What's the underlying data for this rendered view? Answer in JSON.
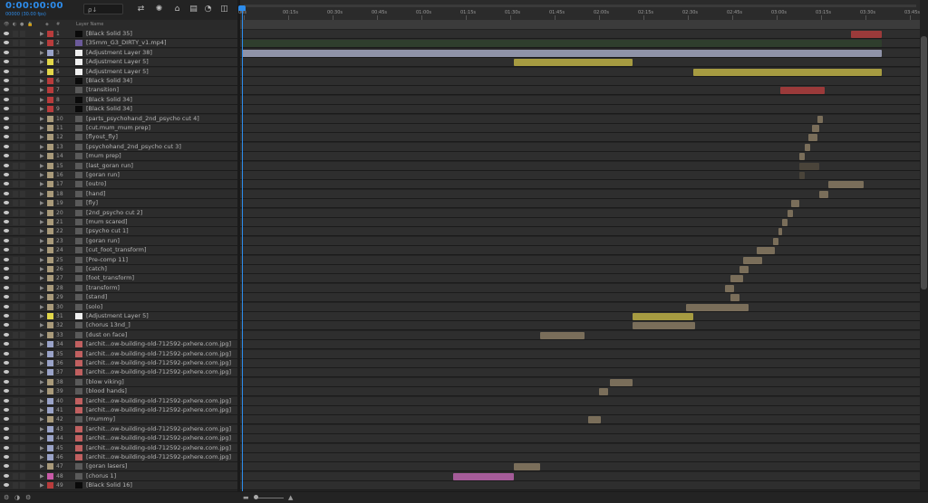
{
  "composition": {
    "timecode": "0:00:00:00",
    "fps": "00000 (30.00 fps)",
    "search_placeholder": "ρ↓"
  },
  "header": {
    "number_label": "#",
    "name_label": "Layer Name"
  },
  "ruler_labels": [
    "00s",
    "00:15s",
    "00:30s",
    "00:45s",
    "01:00s",
    "01:15s",
    "01:30s",
    "01:45s",
    "02:00s",
    "02:15s",
    "02:30s",
    "02:45s",
    "03:00s",
    "03:15s",
    "03:30s",
    "03:45s"
  ],
  "label_colors": {
    "red": "#b83c3c",
    "lavender": "#9aa3c8",
    "yellow": "#e2d74a",
    "sand": "#a99a7a",
    "pink": "#c95aa8"
  },
  "layers": [
    {
      "num": "1",
      "name": "[Black Solid 35]",
      "label": "red",
      "src": "black"
    },
    {
      "num": "2",
      "name": "[35mm_G3_DIRTY_v1.mp4]",
      "label": "red",
      "src": "video"
    },
    {
      "num": "3",
      "name": "[Adjustment Layer 38]",
      "label": "lavender",
      "src": "white"
    },
    {
      "num": "4",
      "name": "[Adjustment Layer 5]",
      "label": "yellow",
      "src": "white"
    },
    {
      "num": "5",
      "name": "[Adjustment Layer 5]",
      "label": "yellow",
      "src": "white"
    },
    {
      "num": "6",
      "name": "[Black Solid 34]",
      "label": "red",
      "src": "black"
    },
    {
      "num": "7",
      "name": "[transition]",
      "label": "red",
      "src": "comp"
    },
    {
      "num": "8",
      "name": "[Black Solid 34]",
      "label": "red",
      "src": "black"
    },
    {
      "num": "9",
      "name": "[Black Solid 34]",
      "label": "red",
      "src": "black"
    },
    {
      "num": "10",
      "name": "[parts_psychohand_2nd_psycho cut 4]",
      "label": "sand",
      "src": "comp"
    },
    {
      "num": "11",
      "name": "[cut.mum_mum prep]",
      "label": "sand",
      "src": "comp"
    },
    {
      "num": "12",
      "name": "[flyout_fly]",
      "label": "sand",
      "src": "comp"
    },
    {
      "num": "13",
      "name": "[psychohand_2nd_psycho cut 3]",
      "label": "sand",
      "src": "comp"
    },
    {
      "num": "14",
      "name": "[mum prep]",
      "label": "sand",
      "src": "comp"
    },
    {
      "num": "15",
      "name": "[last_goran run]",
      "label": "sand",
      "src": "comp"
    },
    {
      "num": "16",
      "name": "[goran run]",
      "label": "sand",
      "src": "comp"
    },
    {
      "num": "17",
      "name": "[outro]",
      "label": "sand",
      "src": "comp"
    },
    {
      "num": "18",
      "name": "[hand]",
      "label": "sand",
      "src": "comp"
    },
    {
      "num": "19",
      "name": "[fly]",
      "label": "sand",
      "src": "comp"
    },
    {
      "num": "20",
      "name": "[2nd_psycho cut 2]",
      "label": "sand",
      "src": "comp"
    },
    {
      "num": "21",
      "name": "[mum scared]",
      "label": "sand",
      "src": "comp"
    },
    {
      "num": "22",
      "name": "[psycho cut 1]",
      "label": "sand",
      "src": "comp"
    },
    {
      "num": "23",
      "name": "[goran run]",
      "label": "sand",
      "src": "comp"
    },
    {
      "num": "24",
      "name": "[cut_foot_transform]",
      "label": "sand",
      "src": "comp"
    },
    {
      "num": "25",
      "name": "[Pre-comp 11]",
      "label": "sand",
      "src": "comp"
    },
    {
      "num": "26",
      "name": "[catch]",
      "label": "sand",
      "src": "comp"
    },
    {
      "num": "27",
      "name": "[foot_transform]",
      "label": "sand",
      "src": "comp"
    },
    {
      "num": "28",
      "name": "[transform]",
      "label": "sand",
      "src": "comp"
    },
    {
      "num": "29",
      "name": "[stand]",
      "label": "sand",
      "src": "comp"
    },
    {
      "num": "30",
      "name": "[solo]",
      "label": "sand",
      "src": "comp"
    },
    {
      "num": "31",
      "name": "[Adjustment Layer 5]",
      "label": "yellow",
      "src": "white"
    },
    {
      "num": "32",
      "name": "[chorus 13nd_]",
      "label": "sand",
      "src": "comp"
    },
    {
      "num": "33",
      "name": "[dust on face]",
      "label": "sand",
      "src": "comp"
    },
    {
      "num": "34",
      "name": "[archit...ow-building-old-712592-pxhere.com.jpg]",
      "label": "lavender",
      "src": "image"
    },
    {
      "num": "35",
      "name": "[archit...ow-building-old-712592-pxhere.com.jpg]",
      "label": "lavender",
      "src": "image"
    },
    {
      "num": "36",
      "name": "[archit...ow-building-old-712592-pxhere.com.jpg]",
      "label": "lavender",
      "src": "image"
    },
    {
      "num": "37",
      "name": "[archit...ow-building-old-712592-pxhere.com.jpg]",
      "label": "lavender",
      "src": "image"
    },
    {
      "num": "38",
      "name": "[blow viking]",
      "label": "sand",
      "src": "comp"
    },
    {
      "num": "39",
      "name": "[blood hands]",
      "label": "sand",
      "src": "comp"
    },
    {
      "num": "40",
      "name": "[archit...ow-building-old-712592-pxhere.com.jpg]",
      "label": "lavender",
      "src": "image"
    },
    {
      "num": "41",
      "name": "[archit...ow-building-old-712592-pxhere.com.jpg]",
      "label": "lavender",
      "src": "image"
    },
    {
      "num": "42",
      "name": "[mummy]",
      "label": "sand",
      "src": "comp"
    },
    {
      "num": "43",
      "name": "[archit...ow-building-old-712592-pxhere.com.jpg]",
      "label": "lavender",
      "src": "image"
    },
    {
      "num": "44",
      "name": "[archit...ow-building-old-712592-pxhere.com.jpg]",
      "label": "lavender",
      "src": "image"
    },
    {
      "num": "45",
      "name": "[archit...ow-building-old-712592-pxhere.com.jpg]",
      "label": "lavender",
      "src": "image"
    },
    {
      "num": "46",
      "name": "[archit...ow-building-old-712592-pxhere.com.jpg]",
      "label": "lavender",
      "src": "image"
    },
    {
      "num": "47",
      "name": "[goran lasers]",
      "label": "sand",
      "src": "comp"
    },
    {
      "num": "48",
      "name": "[chorus 1]",
      "label": "pink",
      "src": "comp"
    },
    {
      "num": "49",
      "name": "[Black Solid 16]",
      "label": "red",
      "src": "black"
    }
  ],
  "clips": [
    {
      "row": 1,
      "color": "#9b3a3a",
      "start": 3.43,
      "end": 3.6
    },
    {
      "row": 2,
      "color": "#2f3e2d",
      "start": 0,
      "end": 3.6
    },
    {
      "row": 3,
      "color": "#8f93a8",
      "start": 0,
      "end": 3.6
    },
    {
      "row": 4,
      "color": "#a69b41",
      "start": 1.53,
      "end": 2.2
    },
    {
      "row": 5,
      "color": "#a69b41",
      "start": 2.54,
      "end": 3.6
    },
    {
      "row": 7,
      "color": "#9b3a3a",
      "start": 3.03,
      "end": 3.28
    },
    {
      "row": 10,
      "color": "#7a6e5a",
      "start": 3.24,
      "end": 3.27
    },
    {
      "row": 11,
      "color": "#7a6e5a",
      "start": 3.21,
      "end": 3.25
    },
    {
      "row": 12,
      "color": "#7a6e5a",
      "start": 3.19,
      "end": 3.24
    },
    {
      "row": 13,
      "color": "#7a6e5a",
      "start": 3.17,
      "end": 3.2
    },
    {
      "row": 14,
      "color": "#7a6e5a",
      "start": 3.14,
      "end": 3.17
    },
    {
      "row": 15,
      "color": "#4a443a",
      "start": 3.14,
      "end": 3.25
    },
    {
      "row": 16,
      "color": "#4a443a",
      "start": 3.14,
      "end": 3.17
    },
    {
      "row": 17,
      "color": "#7a6e5a",
      "start": 3.3,
      "end": 3.5
    },
    {
      "row": 18,
      "color": "#7a6e5a",
      "start": 3.25,
      "end": 3.3
    },
    {
      "row": 19,
      "color": "#7a6e5a",
      "start": 3.09,
      "end": 3.14
    },
    {
      "row": 20,
      "color": "#7a6e5a",
      "start": 3.07,
      "end": 3.1
    },
    {
      "row": 21,
      "color": "#7a6e5a",
      "start": 3.04,
      "end": 3.07
    },
    {
      "row": 22,
      "color": "#7a6e5a",
      "start": 3.02,
      "end": 3.04
    },
    {
      "row": 23,
      "color": "#7a6e5a",
      "start": 2.99,
      "end": 3.02
    },
    {
      "row": 24,
      "color": "#7a6e5a",
      "start": 2.9,
      "end": 3.0
    },
    {
      "row": 25,
      "color": "#7a6e5a",
      "start": 2.82,
      "end": 2.93
    },
    {
      "row": 26,
      "color": "#7a6e5a",
      "start": 2.8,
      "end": 2.85
    },
    {
      "row": 27,
      "color": "#7a6e5a",
      "start": 2.75,
      "end": 2.82
    },
    {
      "row": 28,
      "color": "#7a6e5a",
      "start": 2.72,
      "end": 2.77
    },
    {
      "row": 29,
      "color": "#7a6e5a",
      "start": 2.75,
      "end": 2.8
    },
    {
      "row": 30,
      "color": "#7a6e5a",
      "start": 2.5,
      "end": 2.85
    },
    {
      "row": 31,
      "color": "#a69b41",
      "start": 2.2,
      "end": 2.54
    },
    {
      "row": 32,
      "color": "#7a6e5a",
      "start": 2.2,
      "end": 2.55
    },
    {
      "row": 33,
      "color": "#7a6e5a",
      "start": 1.68,
      "end": 1.93
    },
    {
      "row": 38,
      "color": "#7a6e5a",
      "start": 2.07,
      "end": 2.2
    },
    {
      "row": 39,
      "color": "#7a6e5a",
      "start": 2.01,
      "end": 2.06
    },
    {
      "row": 42,
      "color": "#7a6e5a",
      "start": 1.95,
      "end": 2.02
    },
    {
      "row": 47,
      "color": "#7a6e5a",
      "start": 1.53,
      "end": 1.68
    },
    {
      "row": 48,
      "color": "#a45b98",
      "start": 1.19,
      "end": 1.53
    }
  ],
  "bottom": {
    "zoom_level": 0.15
  }
}
